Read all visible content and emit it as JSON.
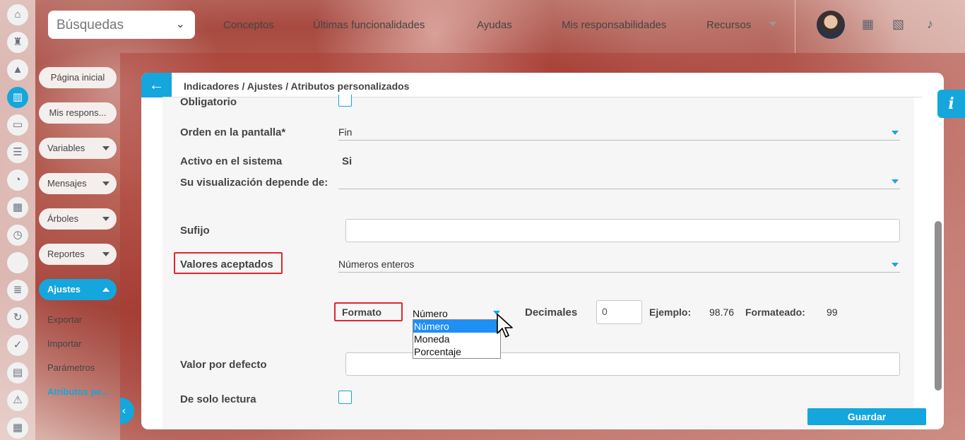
{
  "topbar": {
    "search_label": "Búsquedas",
    "nav": [
      {
        "label": "Conceptos"
      },
      {
        "label": "Últimas funcionalidades"
      },
      {
        "label": "Ayudas"
      },
      {
        "label": "Mis responsabilidades"
      },
      {
        "label": "Recursos"
      }
    ],
    "icons": [
      "calendar-icon",
      "map-icon",
      "bell-icon"
    ]
  },
  "rail_icons": [
    "home-icon",
    "castle-icon",
    "triangle-icon",
    "chart-icon",
    "presentation-icon",
    "sliders-icon",
    "pie-icon",
    "map-icon",
    "clock-icon",
    "blank-icon",
    "document-icon",
    "cycle-icon",
    "check-icon",
    "briefcase-icon",
    "warning-icon",
    "calendar-icon"
  ],
  "sidebar": {
    "items": [
      {
        "label": "Página inicial"
      },
      {
        "label": "Mis respons..."
      },
      {
        "label": "Variables"
      },
      {
        "label": "Mensajes"
      },
      {
        "label": "Árboles"
      },
      {
        "label": "Reportes"
      },
      {
        "label": "Ajustes"
      }
    ],
    "submenu": [
      {
        "label": "Exportar"
      },
      {
        "label": "Importar"
      },
      {
        "label": "Parámetros"
      },
      {
        "label": "Atributos pe..."
      }
    ]
  },
  "header": {
    "breadcrumb": "Indicadores / Ajustes / Atributos personalizados"
  },
  "form": {
    "obligatorio_label": "Obligatorio",
    "orden_label": "Orden en la pantalla*",
    "orden_value": "Fin",
    "activo_label": "Activo en el sistema",
    "activo_value": "Si",
    "depende_label": "Su visualización depende de:",
    "depende_value": "",
    "sufijo_label": "Sufijo",
    "sufijo_value": "",
    "valores_label": "Valores aceptados",
    "valores_value": "Números enteros",
    "formato_label": "Formato",
    "formato_value": "Número",
    "formato_options": [
      "Número",
      "Moneda",
      "Porcentaje"
    ],
    "decimales_label": "Decimales",
    "decimales_value": "0",
    "ejemplo_label": "Ejemplo:",
    "ejemplo_value": "98.76",
    "formateado_label": "Formateado:",
    "formateado_value": "99",
    "defecto_label": "Valor por defecto",
    "defecto_value": "",
    "lectura_label": "De solo lectura",
    "save_label": "Guardar"
  },
  "colors": {
    "accent": "#14a6dd",
    "highlight": "#e0262e",
    "dropdown_selected": "#1e8ff5"
  }
}
